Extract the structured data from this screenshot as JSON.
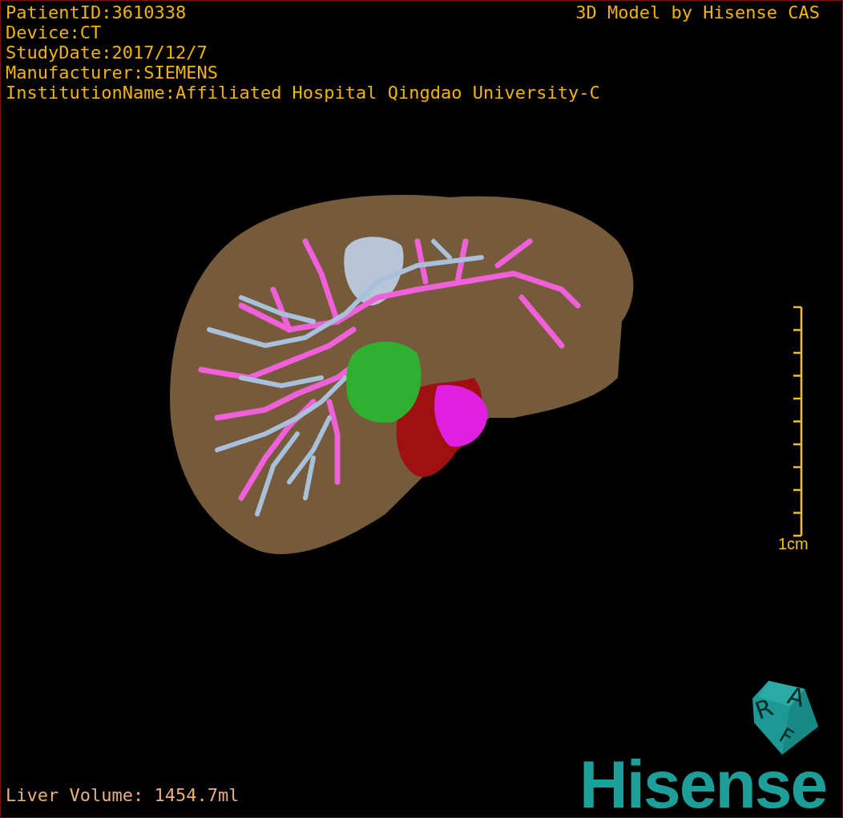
{
  "overlay": {
    "patient_info": [
      "PatientID:3610338",
      "Device:CT",
      "StudyDate:2017/12/7",
      "Manufacturer:SIEMENS",
      "InstitutionName:Affiliated Hospital Qingdao University-C"
    ],
    "credit": "3D Model by Hisense CAS",
    "volume": "Liver Volume: 1454.7ml"
  },
  "scale_bar": {
    "label": "1cm"
  },
  "orientation_cube": {
    "faces": [
      "R",
      "A",
      "F"
    ]
  },
  "logo": "Hisense"
}
